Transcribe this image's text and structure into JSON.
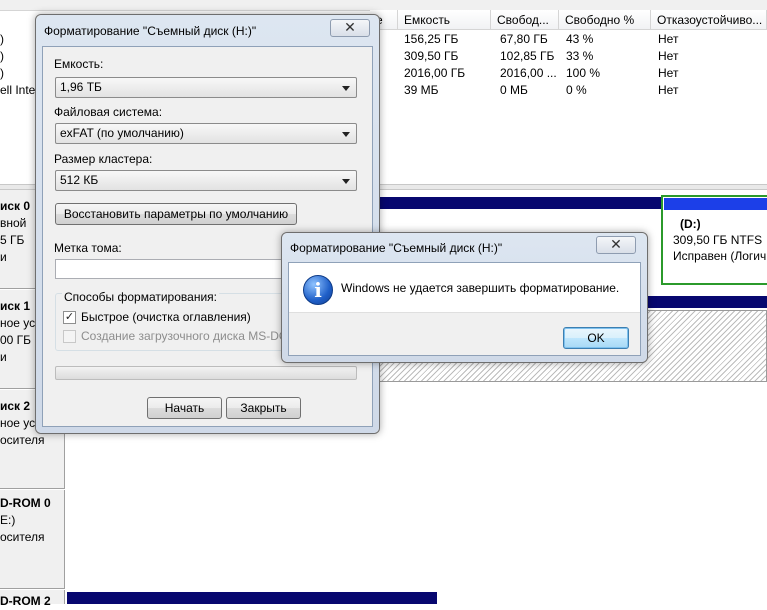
{
  "volume_table": {
    "headers": [
      "е",
      "Емкость",
      "Свобод...",
      "Свободно %",
      "Отказоустойчиво..."
    ],
    "rows": [
      {
        "name": ")",
        "capacity": "156,25 ГБ",
        "free": "67,80 ГБ",
        "free_pct": "43 %",
        "fault_tolerance": "Нет"
      },
      {
        "name": ")",
        "capacity": "309,50 ГБ",
        "free": "102,85 ГБ",
        "free_pct": "33 %",
        "fault_tolerance": "Нет"
      },
      {
        "name": ")",
        "capacity": "2016,00 ГБ",
        "free": "2016,00 ...",
        "free_pct": "100 %",
        "fault_tolerance": "Нет"
      },
      {
        "name": "ell Inter",
        "capacity": "39 МБ",
        "free": "0 МБ",
        "free_pct": "0 %",
        "fault_tolerance": "Нет"
      }
    ]
  },
  "disks": [
    {
      "name": "иск 0",
      "line1": "вной",
      "line2": "5 ГБ",
      "line3": "и"
    },
    {
      "name": "иск 1",
      "line1": "ное ус",
      "line2": "00 ГБ",
      "line3": "и"
    },
    {
      "name": "иск 2",
      "line1": "ное уст",
      "line2": "",
      "line3": "осителя"
    },
    {
      "name": "D-ROM 0",
      "line1": "E:)",
      "line2": "",
      "line3": "осителя"
    },
    {
      "name": "D-ROM 2",
      "line1": "",
      "line2": "",
      "line3": ""
    }
  ],
  "partition_d": {
    "title": "(D:)",
    "size": "309,50 ГБ NTFS",
    "status": "Исправен (Логич"
  },
  "format_dialog": {
    "title": "Форматирование \"Съемный диск (H:)\"",
    "close_symbol": "✕",
    "capacity_label": "Емкость:",
    "capacity_value": "1,96 ТБ",
    "fs_label": "Файловая система:",
    "fs_value": "exFAT (по умолчанию)",
    "cluster_label": "Размер кластера:",
    "cluster_value": "512 КБ",
    "restore_button": "Восстановить параметры по умолчанию",
    "volume_label": "Метка тома:",
    "volume_value": "",
    "methods_label": "Способы форматирования:",
    "quick_label": "Быстрое (очистка оглавления)",
    "quick_checked": true,
    "msdos_label": "Создание загрузочного диска MS-DOS",
    "msdos_checked": false,
    "progress": 0,
    "start_button": "Начать",
    "close_button": "Закрыть"
  },
  "error_dialog": {
    "title": "Форматирование \"Съемный диск (H:)\"",
    "close_symbol": "✕",
    "message": "Windows не удается завершить форматирование.",
    "ok_button": "OK",
    "icon": "info-icon"
  },
  "colors": {
    "disk_bar": "#07076f",
    "partition_border": "#2b9a2b",
    "ok_focus": "#3c7fb1"
  }
}
